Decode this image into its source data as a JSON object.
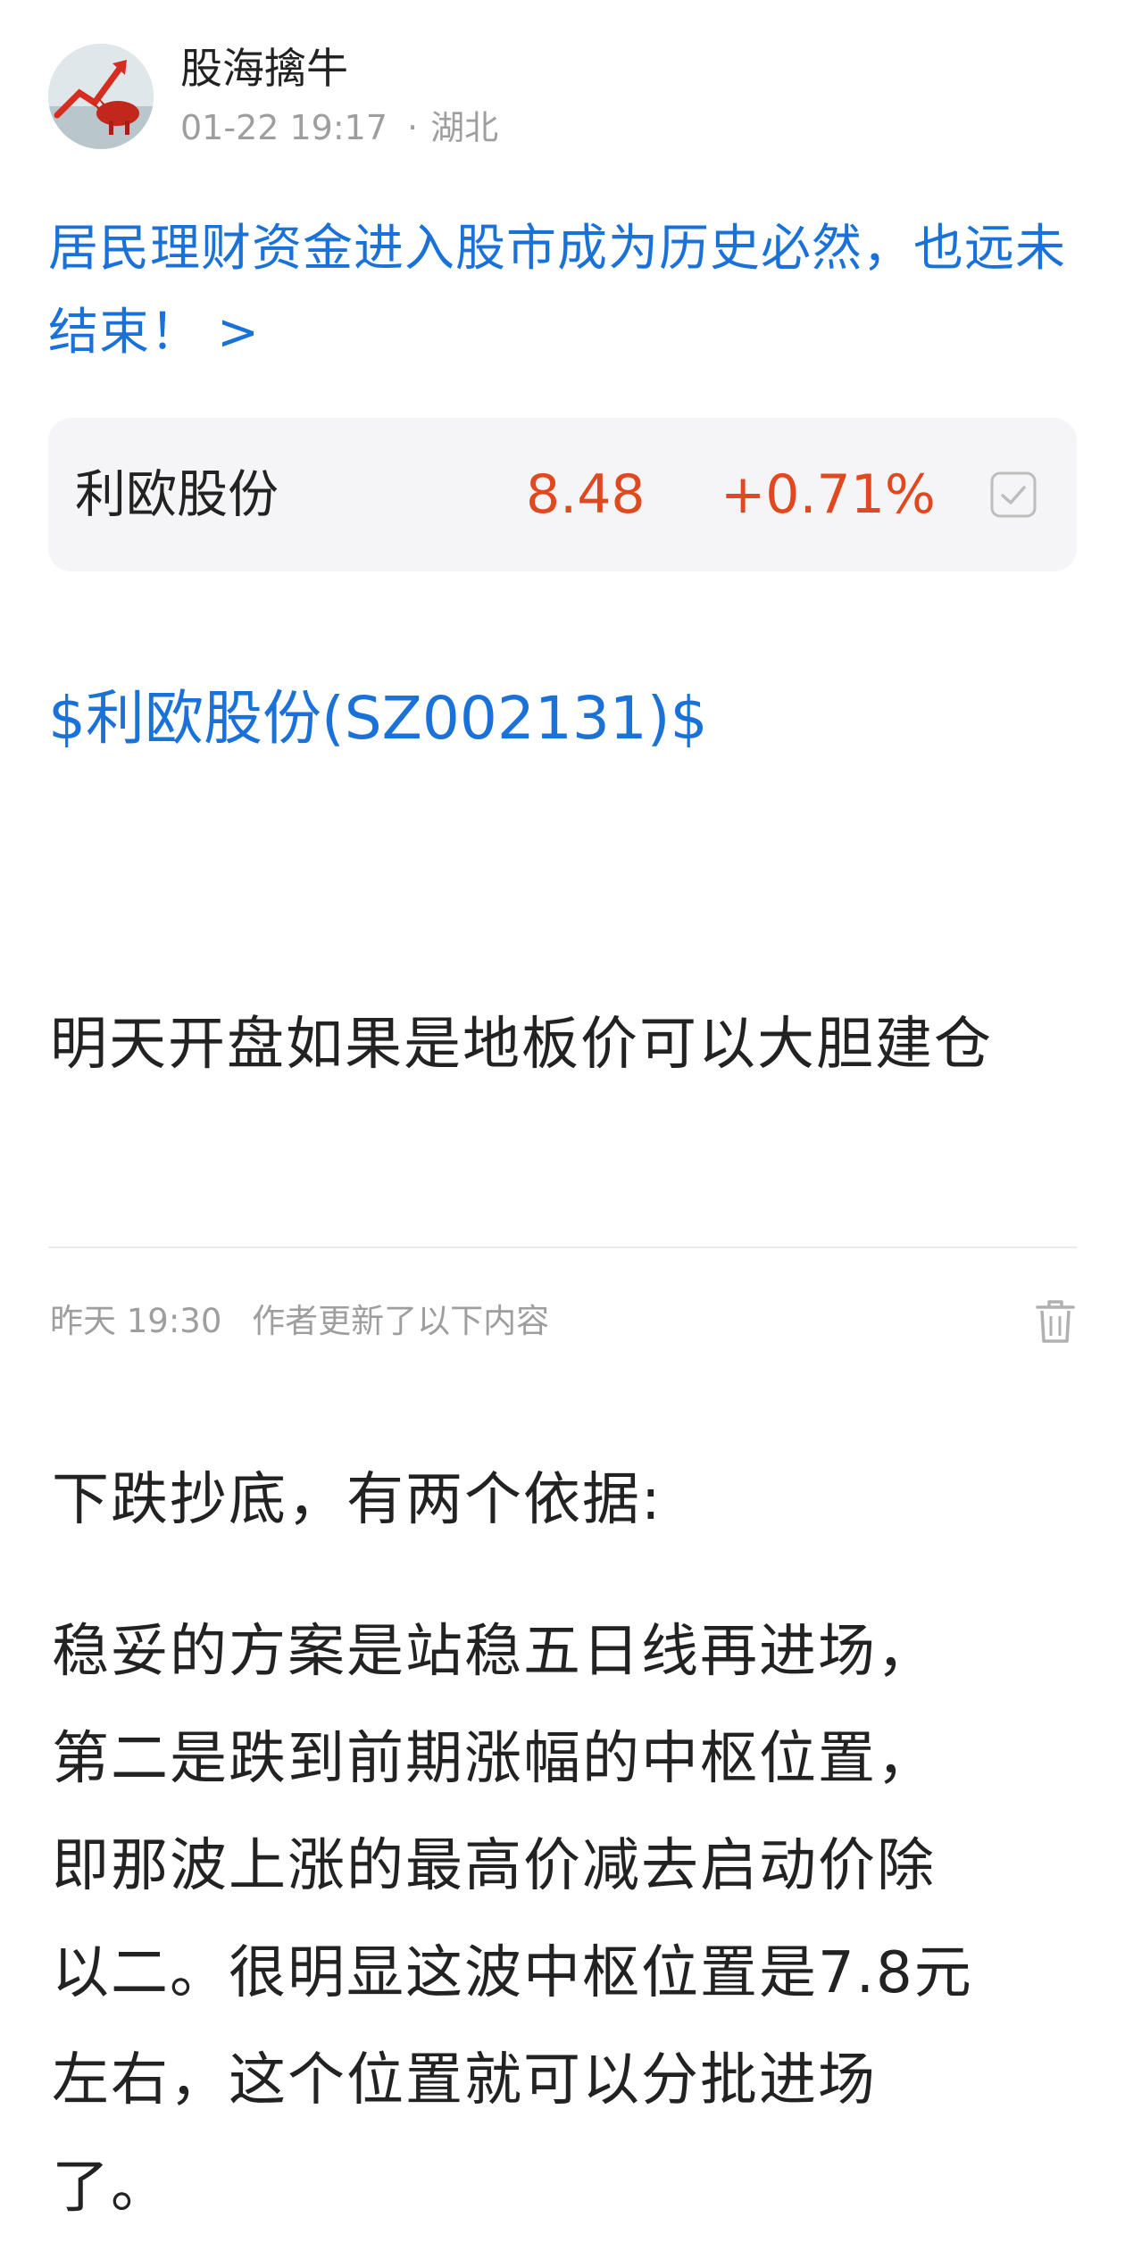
{
  "author": {
    "name": "股海擒牛",
    "time": "01-22 19:17",
    "separator": "·",
    "location": "湖北",
    "avatar_icon": "bull-chart-avatar"
  },
  "topic": {
    "text": "居民理财资金进入股市成为历史必然，也远未结束！",
    "arrow": ">"
  },
  "stock_card": {
    "name": "利欧股份",
    "price": "8.48",
    "change": "+0.71%",
    "price_color": "#e0481f",
    "action_icon": "checkbox-icon"
  },
  "post": {
    "stock_tag": "$利欧股份(SZ002131)$",
    "text": "明天开盘如果是地板价可以大胆建仓"
  },
  "update": {
    "time": "昨天 19:30",
    "note": "作者更新了以下内容",
    "delete_icon": "trash-icon",
    "heading": "下跌抄底，有两个依据:",
    "body_lines": [
      "稳妥的方案是站稳五日线再进场，",
      "第二是跌到前期涨幅的中枢位置，",
      "即那波上涨的最高价减去启动价除",
      "以二。很明显这波中枢位置是7.8元",
      "左右，这个位置就可以分批进场",
      "了。"
    ]
  },
  "colors": {
    "link": "#1a72d9",
    "rise": "#e0481f",
    "muted": "#9e9e9e",
    "text": "#222222"
  }
}
